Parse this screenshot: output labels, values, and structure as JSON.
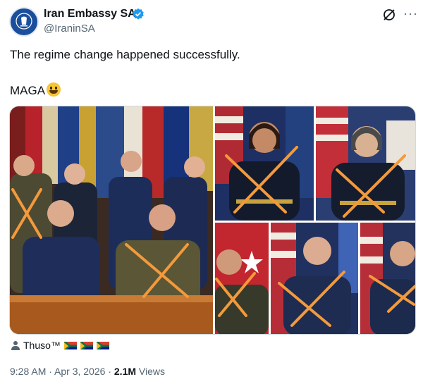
{
  "account": {
    "display_name": "Iran Embassy SA",
    "handle": "@IraninSA",
    "avatar_icon": "embassy-emblem-icon",
    "verified_icon": "verified-badge-icon",
    "verified_color": "#1d9bf0"
  },
  "header_actions": {
    "grok_icon": "grok-icon",
    "more_label": "···"
  },
  "tweet": {
    "line1": "The regime change happened successfully.",
    "line2": "MAGA",
    "emoji": "grinning-face-emoji"
  },
  "media": {
    "photos": [
      {
        "name": "group-photo",
        "subjects": 7,
        "marked": 3
      },
      {
        "name": "admiral-woman-1",
        "subjects": 1,
        "marked": 1
      },
      {
        "name": "admiral-woman-2",
        "subjects": 1,
        "marked": 1
      },
      {
        "name": "army-general",
        "subjects": 1,
        "marked": 1
      },
      {
        "name": "air-force-general",
        "subjects": 1,
        "marked": 1
      },
      {
        "name": "air-force-officer",
        "subjects": 1,
        "marked": 1
      }
    ],
    "cross_color": "#f39a3c"
  },
  "attribution": {
    "user": "Thuso™",
    "user_icon": "person-icon",
    "flags": [
      "south-africa-flag",
      "south-africa-flag",
      "south-africa-flag"
    ]
  },
  "meta": {
    "time": "9:28 AM",
    "separator": " · ",
    "date": "Apr 3, 2026",
    "views_count": "2.1M",
    "views_label": " Views"
  }
}
